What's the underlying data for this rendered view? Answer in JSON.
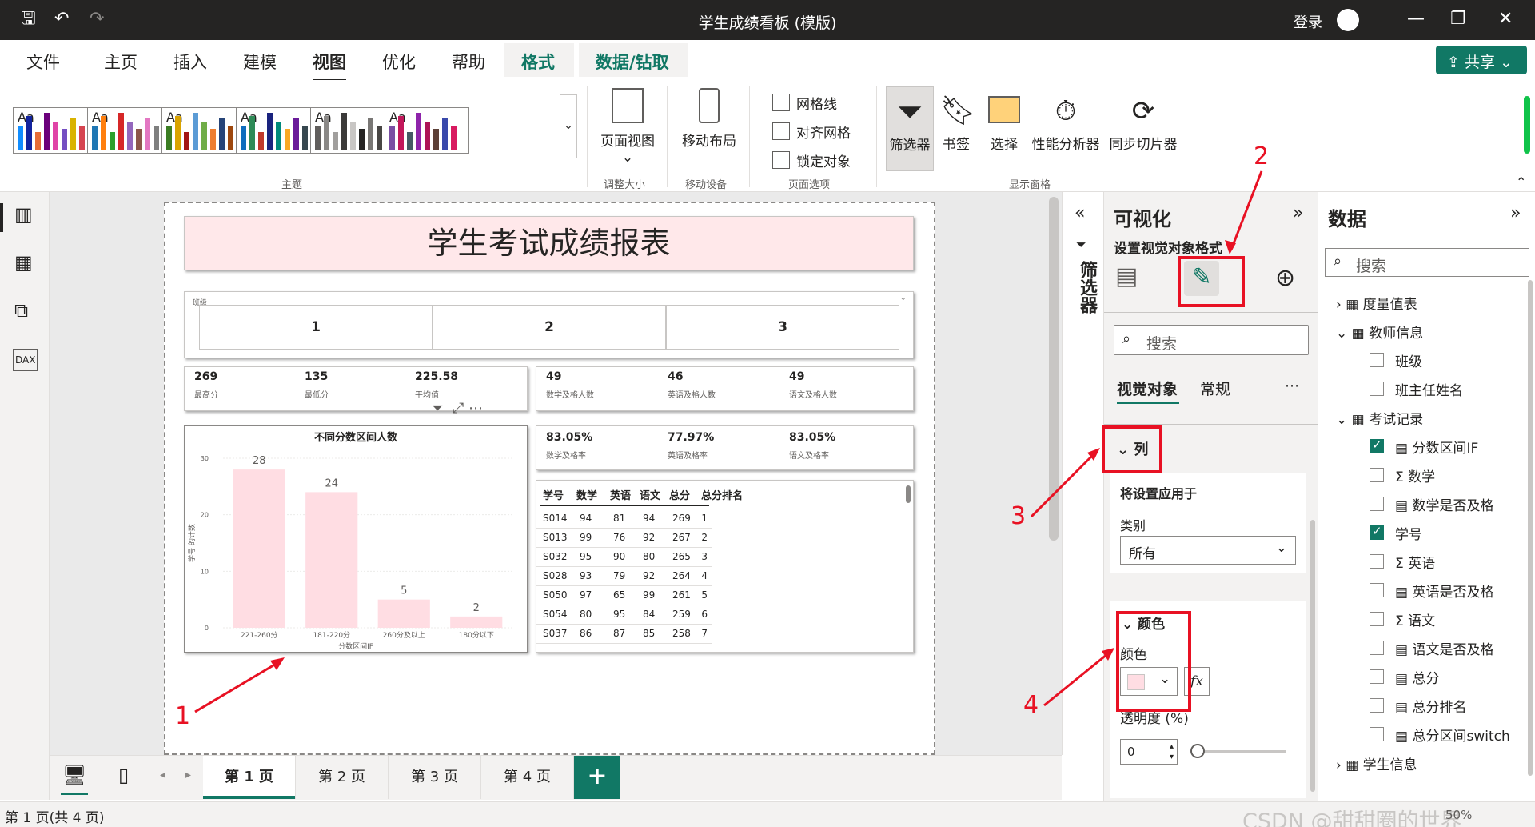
{
  "window": {
    "title": "学生成绩看板 (模版)",
    "login": "登录"
  },
  "menu": {
    "items": [
      "文件",
      "主页",
      "插入",
      "建模",
      "视图",
      "优化",
      "帮助"
    ],
    "ctx1": "格式",
    "ctx2": "数据/钻取",
    "share": "共享"
  },
  "ribbon": {
    "theme_group": "主题",
    "aa": "Aa",
    "page_view": "页面视图",
    "fit_group": "调整大小",
    "mobile_layout": "移动布局",
    "mobile_group": "移动设备",
    "gridlines": "网格线",
    "snap_grid": "对齐网格",
    "lock_objects": "锁定对象",
    "page_options_group": "页面选项",
    "filter": "筛选器",
    "bookmark": "书签",
    "selection": "选择",
    "perf": "性能分析器",
    "sync_slicers": "同步切片器",
    "show_panes_group": "显示窗格"
  },
  "report": {
    "title": "学生考试成绩报表",
    "slicer": {
      "label": "班级",
      "items": [
        "1",
        "2",
        "3"
      ]
    },
    "kpi1": [
      {
        "v": "269",
        "l": "最高分"
      },
      {
        "v": "135",
        "l": "最低分"
      },
      {
        "v": "225.58",
        "l": "平均值"
      }
    ],
    "kpi2": [
      {
        "v": "49",
        "l": "数学及格人数"
      },
      {
        "v": "46",
        "l": "英语及格人数"
      },
      {
        "v": "49",
        "l": "语文及格人数"
      }
    ],
    "kpi3": [
      {
        "v": "83.05%",
        "l": "数学及格率"
      },
      {
        "v": "77.97%",
        "l": "英语及格率"
      },
      {
        "v": "83.05%",
        "l": "语文及格率"
      }
    ],
    "table": {
      "headers": [
        "学号",
        "数学",
        "英语",
        "语文",
        "总分",
        "总分排名"
      ],
      "rows": [
        [
          "S014",
          "94",
          "81",
          "94",
          "269",
          "1"
        ],
        [
          "S013",
          "99",
          "76",
          "92",
          "267",
          "2"
        ],
        [
          "S032",
          "95",
          "90",
          "80",
          "265",
          "3"
        ],
        [
          "S028",
          "93",
          "79",
          "92",
          "264",
          "4"
        ],
        [
          "S050",
          "97",
          "65",
          "99",
          "261",
          "5"
        ],
        [
          "S054",
          "80",
          "95",
          "84",
          "259",
          "6"
        ],
        [
          "S037",
          "86",
          "87",
          "85",
          "258",
          "7"
        ]
      ]
    }
  },
  "chart_data": {
    "type": "bar",
    "title": "不同分数区间人数",
    "xlabel": "分数区间IF",
    "ylabel": "学号 的计数",
    "categories": [
      "221-260分",
      "181-220分",
      "260分及以上",
      "180分以下"
    ],
    "values": [
      28,
      24,
      5,
      2
    ],
    "ylim": [
      0,
      30
    ],
    "yticks": [
      "0",
      "10",
      "20",
      "30"
    ],
    "bar_color": "#ffdde3"
  },
  "filters_pane": {
    "label": "筛选器"
  },
  "viz_pane": {
    "title": "可视化",
    "subtitle": "设置视觉对象格式",
    "search": "搜索",
    "tab_visual": "视觉对象",
    "tab_general": "常规",
    "more": "···",
    "section_column": "列",
    "apply_to": "将设置应用于",
    "category_label": "类别",
    "category_value": "所有",
    "section_color": "颜色",
    "color_label": "颜色",
    "fx": "fx",
    "transparency_label": "透明度 (%)",
    "transparency_value": "0"
  },
  "data_pane": {
    "title": "数据",
    "search": "搜索",
    "tables": [
      {
        "name": "度量值表",
        "expanded": false
      },
      {
        "name": "教师信息",
        "expanded": true,
        "fields": [
          "班级",
          "班主任姓名"
        ]
      },
      {
        "name": "考试记录",
        "expanded": true,
        "fields": [
          "分数区间IF",
          "数学",
          "数学是否及格",
          "学号",
          "英语",
          "英语是否及格",
          "语文",
          "语文是否及格",
          "总分",
          "总分排名",
          "总分区间switch"
        ]
      },
      {
        "name": "学生信息",
        "expanded": false
      }
    ]
  },
  "tabs": {
    "pages": [
      "第 1 页",
      "第 2 页",
      "第 3 页",
      "第 4 页"
    ],
    "add": "+"
  },
  "status": {
    "page_info": "第 1 页(共 4 页)",
    "zoom": "50%",
    "watermark": "CSDN @甜甜圈的世界"
  },
  "annotations": [
    "1",
    "2",
    "3",
    "4"
  ],
  "colors": {
    "accent": "#117865",
    "annotation": "#e81123",
    "titlebar": "#252423"
  }
}
